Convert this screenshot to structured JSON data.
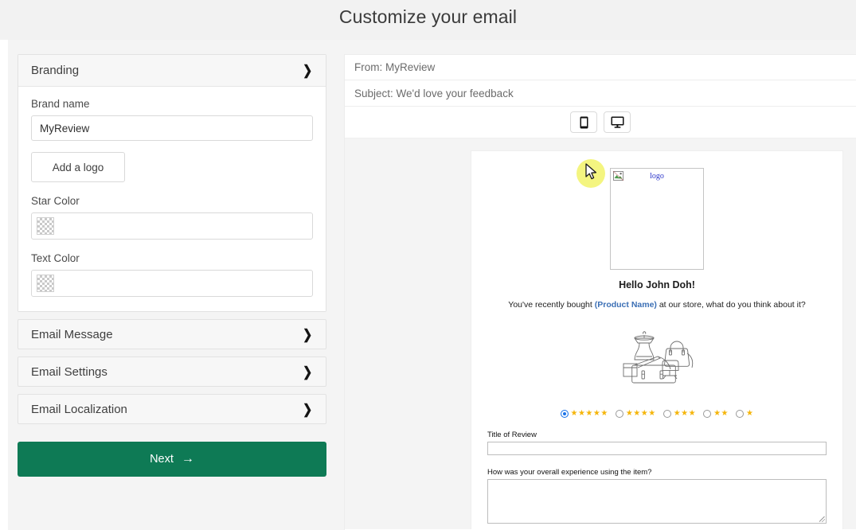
{
  "header": {
    "title": "Customize your email"
  },
  "settings": {
    "branding": {
      "title": "Branding",
      "chevron": "❯",
      "brand_name_label": "Brand name",
      "brand_name_value": "MyReview",
      "add_logo_label": "Add a logo",
      "star_color_label": "Star Color",
      "star_color_value": "",
      "text_color_label": "Text Color",
      "text_color_value": ""
    },
    "sections": [
      {
        "title": "Email Message",
        "chevron": "❯"
      },
      {
        "title": "Email Settings",
        "chevron": "❯"
      },
      {
        "title": "Email Localization",
        "chevron": "❯"
      }
    ],
    "next_button": {
      "label": "Next",
      "arrow": "→",
      "color": "#0e7a55"
    }
  },
  "preview": {
    "from_line": "From: MyReview",
    "subject_line": "Subject: We'd love your feedback",
    "devices": [
      {
        "name": "mobile-view-button",
        "icon": "phone-icon"
      },
      {
        "name": "desktop-view-button",
        "icon": "desktop-icon"
      }
    ],
    "email": {
      "logo_alt": "logo",
      "greeting": "Hello John Doh!",
      "lead_before": "You've recently bought ",
      "lead_product": "(Product Name)",
      "lead_after": " at our store, what do you think about it?",
      "product_illustration": "bags-illustration",
      "rating_options": [
        {
          "stars": 5,
          "selected": true
        },
        {
          "stars": 4,
          "selected": false
        },
        {
          "stars": 3,
          "selected": false
        },
        {
          "stars": 2,
          "selected": false
        },
        {
          "stars": 1,
          "selected": false
        }
      ],
      "star_glyph": "★",
      "title_label": "Title of Review",
      "title_value": "",
      "experience_label": "How was your overall experience using the item?",
      "experience_value": ""
    }
  },
  "colors": {
    "accent_green": "#0e7a55",
    "star_yellow": "#f5b50a",
    "radio_blue": "#1a73e8",
    "link_blue": "#3b6fb5",
    "page_bg": "#f4f4f4"
  }
}
